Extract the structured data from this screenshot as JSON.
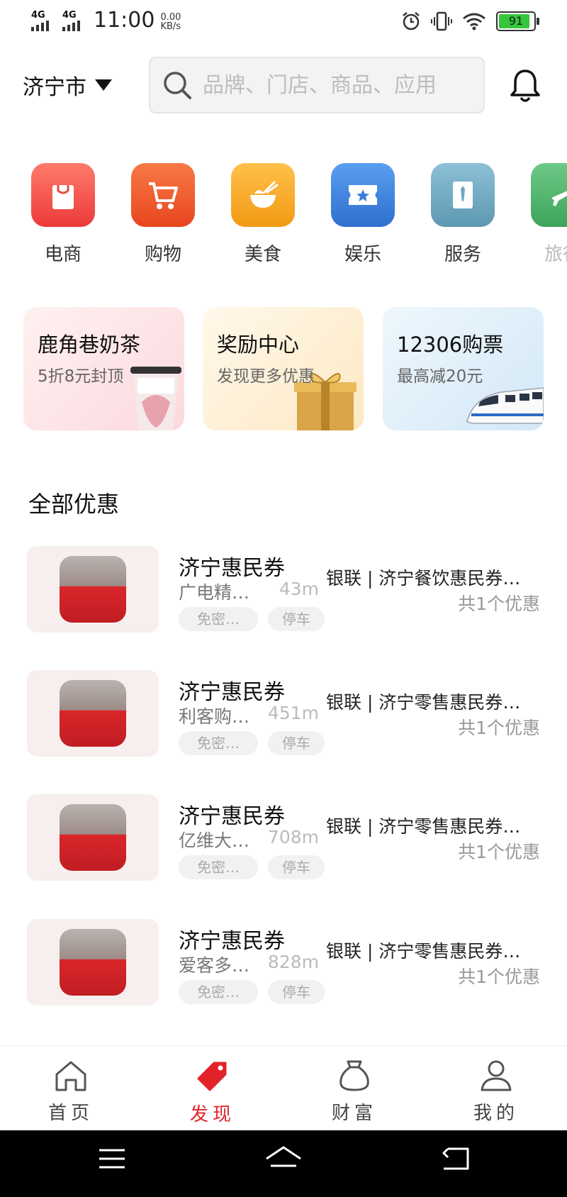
{
  "status_bar": {
    "network_1": "4G",
    "network_2": "4G",
    "time": "11:00",
    "speed_value": "0.00",
    "speed_unit": "KB/s",
    "battery": "91",
    "battery_level": 0.91,
    "battery_color": "#36c63c"
  },
  "header": {
    "city": "济宁市",
    "search_placeholder": "品牌、门店、商品、应用"
  },
  "categories": [
    {
      "label": "电商",
      "icon": "shopping-bag-icon",
      "color": "#ee4444"
    },
    {
      "label": "购物",
      "icon": "cart-icon",
      "color": "#ee5224"
    },
    {
      "label": "美食",
      "icon": "rice-bowl-icon",
      "color": "#f6a21d"
    },
    {
      "label": "娱乐",
      "icon": "ticket-icon",
      "color": "#3b7fd9"
    },
    {
      "label": "服务",
      "icon": "tie-icon",
      "color": "#6fa7bf"
    },
    {
      "label": "旅行",
      "icon": "plane-icon",
      "color": "#3ea45a"
    }
  ],
  "promos": [
    {
      "title": "鹿角巷奶茶",
      "subtitle": "5折8元封顶"
    },
    {
      "title": "奖励中心",
      "subtitle": "发现更多优惠"
    },
    {
      "title": "12306购票",
      "subtitle": "最高减20元"
    }
  ],
  "section_title": "全部优惠",
  "deals": [
    {
      "name": "济宁惠民券",
      "store": "广电精…",
      "distance": "43m",
      "tag1": "免密…",
      "tag2": "停车",
      "offer": "银联 | 济宁餐饮惠民券…",
      "count": "共1个优惠"
    },
    {
      "name": "济宁惠民券",
      "store": "利客购…",
      "distance": "451m",
      "tag1": "免密…",
      "tag2": "停车",
      "offer": "银联 | 济宁零售惠民券…",
      "count": "共1个优惠"
    },
    {
      "name": "济宁惠民券",
      "store": "亿维大…",
      "distance": "708m",
      "tag1": "免密…",
      "tag2": "停车",
      "offer": "银联 | 济宁零售惠民券…",
      "count": "共1个优惠"
    },
    {
      "name": "济宁惠民券",
      "store": "爱客多…",
      "distance": "828m",
      "tag1": "免密…",
      "tag2": "停车",
      "offer": "银联 | 济宁零售惠民券…",
      "count": "共1个优惠"
    }
  ],
  "bottom_nav": [
    {
      "label": "首页",
      "icon": "home-icon"
    },
    {
      "label": "发现",
      "icon": "tag-icon",
      "active": true
    },
    {
      "label": "财富",
      "icon": "money-bag-icon"
    },
    {
      "label": "我的",
      "icon": "user-icon"
    }
  ],
  "colors": {
    "accent": "#e2232a"
  }
}
